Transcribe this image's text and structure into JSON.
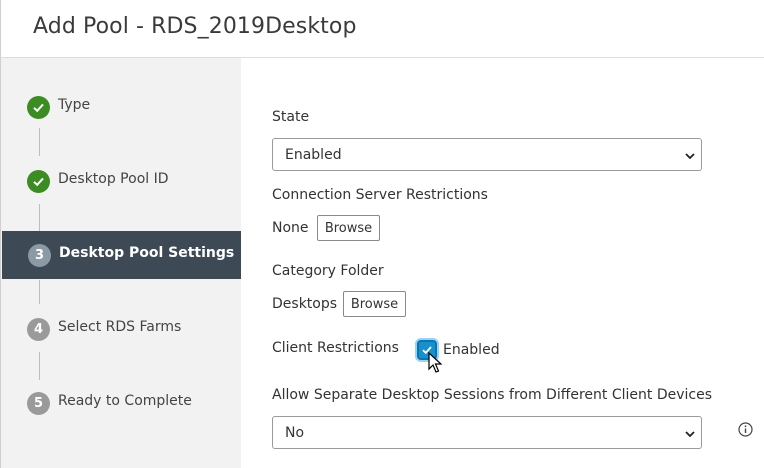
{
  "header": {
    "title": "Add Pool - RDS_2019Desktop"
  },
  "wizard": {
    "steps": [
      {
        "marker": "",
        "label": "Type",
        "state": "done"
      },
      {
        "marker": "",
        "label": "Desktop Pool ID",
        "state": "done"
      },
      {
        "marker": "3",
        "label": "Desktop Pool Settings",
        "state": "active"
      },
      {
        "marker": "4",
        "label": "Select RDS Farms",
        "state": "pending"
      },
      {
        "marker": "5",
        "label": "Ready to Complete",
        "state": "pending"
      }
    ]
  },
  "form": {
    "state": {
      "label": "State",
      "value": "Enabled"
    },
    "connection_server": {
      "label": "Connection Server Restrictions",
      "value": "None",
      "browse": "Browse"
    },
    "category_folder": {
      "label": "Category Folder",
      "value": "Desktops",
      "browse": "Browse"
    },
    "client_restrictions": {
      "label": "Client Restrictions",
      "checkbox_label": "Enabled",
      "checked": true
    },
    "separate_sessions": {
      "label": "Allow Separate Desktop Sessions from Different Client Devices",
      "value": "No"
    }
  },
  "colors": {
    "accent": "#0079b8",
    "done": "#3b8c23",
    "active_bg": "#3d4a56"
  }
}
